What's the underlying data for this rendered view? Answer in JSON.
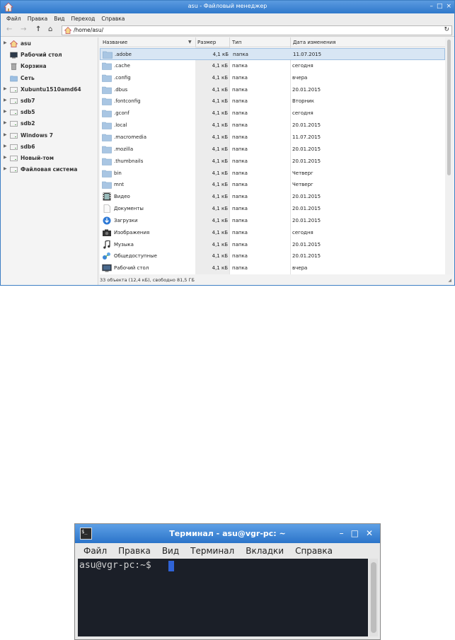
{
  "file_manager": {
    "title": "asu - Файловый менеджер",
    "menu": [
      "Файл",
      "Правка",
      "Вид",
      "Переход",
      "Справка"
    ],
    "path": "/home/asu/",
    "sidebar": [
      {
        "label": "asu",
        "icon": "home-icon",
        "expandable": true
      },
      {
        "label": "Рабочий стол",
        "icon": "desktop-icon",
        "expandable": false
      },
      {
        "label": "Корзина",
        "icon": "trash-icon",
        "expandable": false
      },
      {
        "label": "Сеть",
        "icon": "network-icon",
        "expandable": false
      },
      {
        "label": "Xubuntu1510amd64",
        "icon": "drive-icon",
        "expandable": true
      },
      {
        "label": "sdb7",
        "icon": "drive-icon",
        "expandable": true
      },
      {
        "label": "sdb5",
        "icon": "drive-icon",
        "expandable": true
      },
      {
        "label": "sdb2",
        "icon": "drive-icon",
        "expandable": true
      },
      {
        "label": "Windows 7",
        "icon": "drive-icon",
        "expandable": true
      },
      {
        "label": "sdb6",
        "icon": "drive-icon",
        "expandable": true
      },
      {
        "label": "Новый-том",
        "icon": "drive-icon",
        "expandable": true
      },
      {
        "label": "Файловая система",
        "icon": "drive-icon",
        "expandable": true
      }
    ],
    "columns": {
      "name": "Название",
      "size": "Размер",
      "type": "Тип",
      "date": "Дата изменения"
    },
    "files": [
      {
        "name": ".adobe",
        "size": "4,1 кБ",
        "type": "папка",
        "date": "11.07.2015",
        "icon": "folder-icon"
      },
      {
        "name": ".cache",
        "size": "4,1 кБ",
        "type": "папка",
        "date": "сегодня",
        "icon": "folder-icon"
      },
      {
        "name": ".config",
        "size": "4,1 кБ",
        "type": "папка",
        "date": "вчера",
        "icon": "folder-icon"
      },
      {
        "name": ".dbus",
        "size": "4,1 кБ",
        "type": "папка",
        "date": "20.01.2015",
        "icon": "folder-icon"
      },
      {
        "name": ".fontconfig",
        "size": "4,1 кБ",
        "type": "папка",
        "date": "Вторник",
        "icon": "folder-icon"
      },
      {
        "name": ".gconf",
        "size": "4,1 кБ",
        "type": "папка",
        "date": "сегодня",
        "icon": "folder-icon"
      },
      {
        "name": ".local",
        "size": "4,1 кБ",
        "type": "папка",
        "date": "20.01.2015",
        "icon": "folder-icon"
      },
      {
        "name": ".macromedia",
        "size": "4,1 кБ",
        "type": "папка",
        "date": "11.07.2015",
        "icon": "folder-icon"
      },
      {
        "name": ".mozilla",
        "size": "4,1 кБ",
        "type": "папка",
        "date": "20.01.2015",
        "icon": "folder-icon"
      },
      {
        "name": ".thumbnails",
        "size": "4,1 кБ",
        "type": "папка",
        "date": "20.01.2015",
        "icon": "folder-icon"
      },
      {
        "name": "bin",
        "size": "4,1 кБ",
        "type": "папка",
        "date": "Четверг",
        "icon": "folder-icon"
      },
      {
        "name": "mnt",
        "size": "4,1 кБ",
        "type": "папка",
        "date": "Четверг",
        "icon": "folder-icon"
      },
      {
        "name": "Видео",
        "size": "4,1 кБ",
        "type": "папка",
        "date": "20.01.2015",
        "icon": "video-icon"
      },
      {
        "name": "Документы",
        "size": "4,1 кБ",
        "type": "папка",
        "date": "20.01.2015",
        "icon": "document-icon"
      },
      {
        "name": "Загрузки",
        "size": "4,1 кБ",
        "type": "папка",
        "date": "20.01.2015",
        "icon": "download-icon"
      },
      {
        "name": "Изображения",
        "size": "4,1 кБ",
        "type": "папка",
        "date": "сегодня",
        "icon": "camera-icon"
      },
      {
        "name": "Музыка",
        "size": "4,1 кБ",
        "type": "папка",
        "date": "20.01.2015",
        "icon": "music-icon"
      },
      {
        "name": "Общедоступные",
        "size": "4,1 кБ",
        "type": "папка",
        "date": "20.01.2015",
        "icon": "share-icon"
      },
      {
        "name": "Рабочий стол",
        "size": "4,1 кБ",
        "type": "папка",
        "date": "вчера",
        "icon": "desktop-icon"
      }
    ],
    "status": "33 объекта (12,4 кБ), свободно 81,5 ГБ"
  },
  "terminal": {
    "title": "Терминал - asu@vgr-pc: ~",
    "menu": [
      "Файл",
      "Правка",
      "Вид",
      "Терминал",
      "Вкладки",
      "Справка"
    ],
    "prompt": "asu@vgr-pc:~$ "
  },
  "colors": {
    "titlebar": "#2f78cb",
    "selection": "#d8e6f4",
    "terminal_bg": "#1b1f28",
    "cursor": "#2f63d6"
  }
}
